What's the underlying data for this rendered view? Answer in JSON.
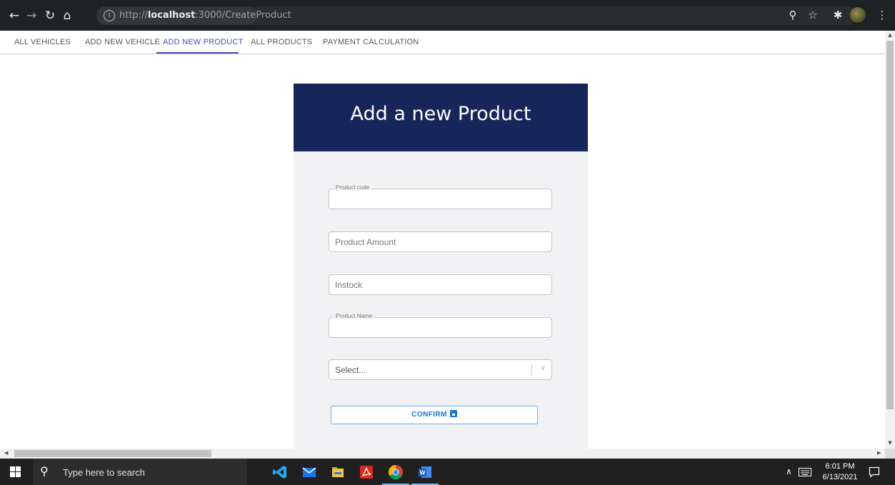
{
  "browser": {
    "url_prefix": "http://",
    "url_host": "localhost",
    "url_rest": ":3000/CreateProduct"
  },
  "nav": {
    "tabs": [
      {
        "label": "ALL VEHICLES"
      },
      {
        "label": "ADD NEW VEHICLE"
      },
      {
        "label": "ADD NEW PRODUCT"
      },
      {
        "label": "ALL PRODUCTS"
      },
      {
        "label": "PAYMENT CALCULATION"
      }
    ],
    "active_index": 2
  },
  "form": {
    "title": "Add a new Product",
    "product_code_label": "Product code",
    "product_amount_placeholder": "Product Amount",
    "instock_placeholder": "Instock",
    "product_name_label": "Product Name",
    "select_placeholder": "Select...",
    "confirm_label": "CONFIRM"
  },
  "taskbar": {
    "search_placeholder": "Type here to search",
    "time": "6:01 PM",
    "date": "6/13/2021"
  },
  "colors": {
    "header_bg": "#16255a",
    "active_tab": "#3f51b5",
    "confirm_text": "#1976d2",
    "confirm_border": "#64b5f6"
  },
  "icons": [
    "back-arrow-icon",
    "forward-arrow-icon",
    "reload-icon",
    "home-icon",
    "info-icon",
    "zoom-icon",
    "star-icon",
    "extensions-icon",
    "menu-dots-icon",
    "save-icon",
    "windows-icon",
    "search-icon",
    "vscode-icon",
    "mail-icon",
    "file-explorer-icon",
    "acrobat-icon",
    "chrome-icon",
    "word-icon",
    "chevron-up-icon",
    "keyboard-icon",
    "notification-icon"
  ]
}
